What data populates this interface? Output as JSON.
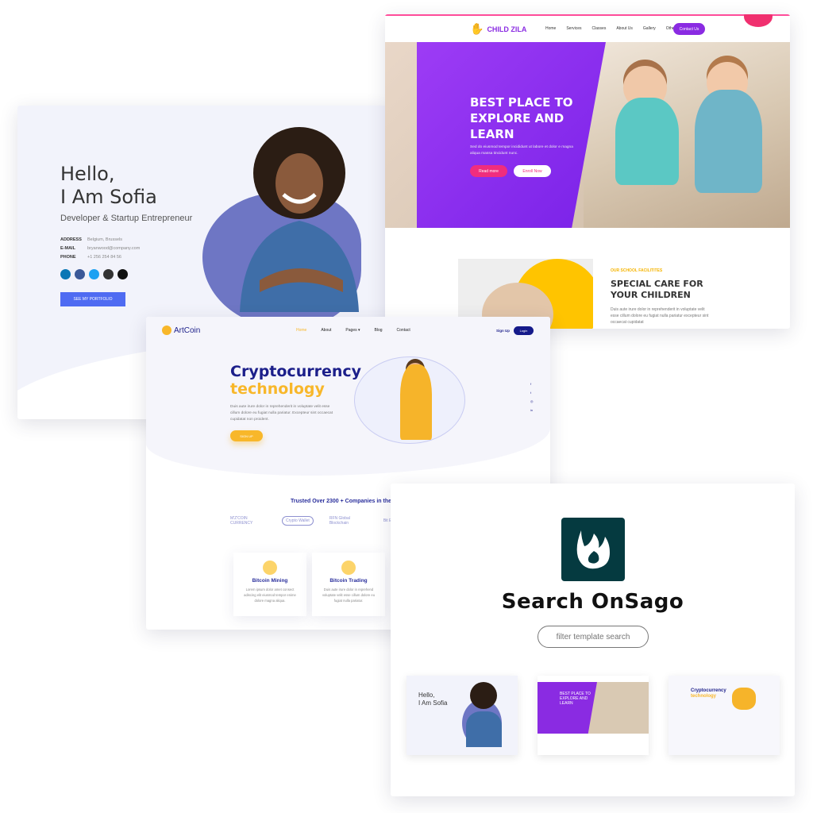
{
  "portfolio": {
    "greeting_line1": "Hello,",
    "greeting_line2": "I Am Sofia",
    "subtitle": "Developer & Startup Entrepreneur",
    "info": [
      {
        "label": "ADDRESS",
        "value": "Belgium, Brussels"
      },
      {
        "label": "E-MAIL",
        "value": "bryanwood@company.com"
      },
      {
        "label": "PHONE",
        "value": "+1 256 254 84 56"
      }
    ],
    "socials": [
      "linkedin",
      "facebook",
      "twitter",
      "github",
      "dribbble"
    ],
    "button": "SEE MY PORTFOLIO"
  },
  "childzila": {
    "brand": "CHILD ZILA",
    "nav": [
      "Home",
      "Services",
      "Classes",
      "About Us",
      "Gallery",
      "Other"
    ],
    "contact": "Contact Us",
    "hero_title": "BEST PLACE TO EXPLORE AND LEARN",
    "hero_text": "Sed do eiusmod tempor incididunt ut labore et dolor e magna aliqua massa tincidunt nunc.",
    "read_more": "Read more",
    "enroll": "Enroll Now",
    "section_label": "OUR SCHOOL FACILITITES",
    "section_title": "SPECIAL CARE FOR YOUR CHILDREN",
    "section_text": "Duis aute irure dolor in reprehenderit in voluptate velit esse cillum dolore eu fugiat nulla pariatur excepteur sint occaecat cupidatat",
    "accent": "#8a2be2"
  },
  "artcoin": {
    "brand": "ArtCoin",
    "nav": [
      "Home",
      "About",
      "Pages ▾",
      "Blog",
      "Contact"
    ],
    "signup_link": "Sign Up",
    "login": "Login",
    "title_line1": "Cryptocurrency",
    "title_line2": "technology",
    "text": "Duis aute irure dolor in reprehenderit in voluptate velit esse cillum dolore eu fugiat nulla pariatur. Excepteur sint occaecat cupidatat non proident.",
    "cta": "SIGN UP",
    "socials": [
      "f",
      "t",
      "◎",
      "in"
    ],
    "trusted": "Trusted Over 2300 + Companies in the",
    "partners": [
      "M'Z'COIN CURRENCY",
      "Crypto Wallet",
      "RFN Global Blockchain",
      "Bit Ex"
    ],
    "features": [
      {
        "title": "Bitcoin Mining",
        "text": "Lorem ipsum dolor amet consect adiscing elit eiusmod tempor enime dolore magna aliqua."
      },
      {
        "title": "Bitcoin Trading",
        "text": "Duis aute irure dolor in reprehend voluptate velit esse cillum dolore eu fugiat nulla pariatur."
      }
    ]
  },
  "onsago": {
    "title": "Search OnSago",
    "search_placeholder": "filter template search",
    "logo_color": "#053a40",
    "thumbs": [
      {
        "l1": "Hello,",
        "l2": "I Am Sofia"
      },
      {
        "l1": "BEST PLACE TO",
        "l2": "EXPLORE AND LEARN"
      },
      {
        "l1": "Cryptocurrency",
        "l2": "technology"
      }
    ]
  }
}
